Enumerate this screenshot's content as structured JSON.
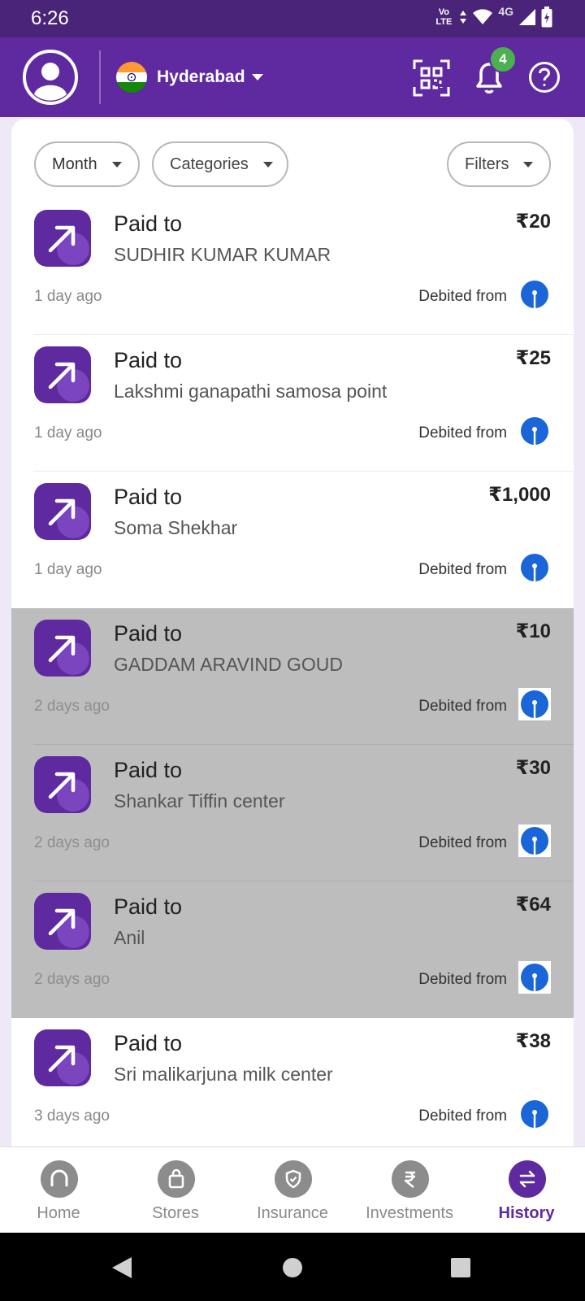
{
  "status": {
    "time": "6:26",
    "volte": "Vo LTE",
    "network": "4G"
  },
  "header": {
    "city": "Hyderabad",
    "notification_count": "4"
  },
  "filters": {
    "month": "Month",
    "categories": "Categories",
    "filters": "Filters"
  },
  "transactions": [
    {
      "title": "Paid to",
      "name": "SUDHIR KUMAR KUMAR",
      "amount": "₹20",
      "time": "1 day ago",
      "debit": "Debited from"
    },
    {
      "title": "Paid to",
      "name": "Lakshmi ganapathi samosa point",
      "amount": "₹25",
      "time": "1 day ago",
      "debit": "Debited from"
    },
    {
      "title": "Paid to",
      "name": "Soma Shekhar",
      "amount": "₹1,000",
      "time": "1 day ago",
      "debit": "Debited from"
    },
    {
      "title": "Paid to",
      "name": "GADDAM ARAVIND GOUD",
      "amount": "₹10",
      "time": "2 days ago",
      "debit": "Debited from"
    },
    {
      "title": "Paid to",
      "name": "Shankar Tiffin center",
      "amount": "₹30",
      "time": "2 days ago",
      "debit": "Debited from"
    },
    {
      "title": "Paid to",
      "name": "Anil",
      "amount": "₹64",
      "time": "2 days ago",
      "debit": "Debited from"
    },
    {
      "title": "Paid to",
      "name": "Sri malikarjuna milk center",
      "amount": "₹38",
      "time": "3 days ago",
      "debit": "Debited from"
    }
  ],
  "nav": {
    "home": "Home",
    "stores": "Stores",
    "insurance": "Insurance",
    "investments": "Investments",
    "history": "History"
  },
  "colors": {
    "brand": "#5f2aa0",
    "status_bar": "#4a2479",
    "badge": "#4caf50",
    "bank_icon": "#1a66d9"
  }
}
